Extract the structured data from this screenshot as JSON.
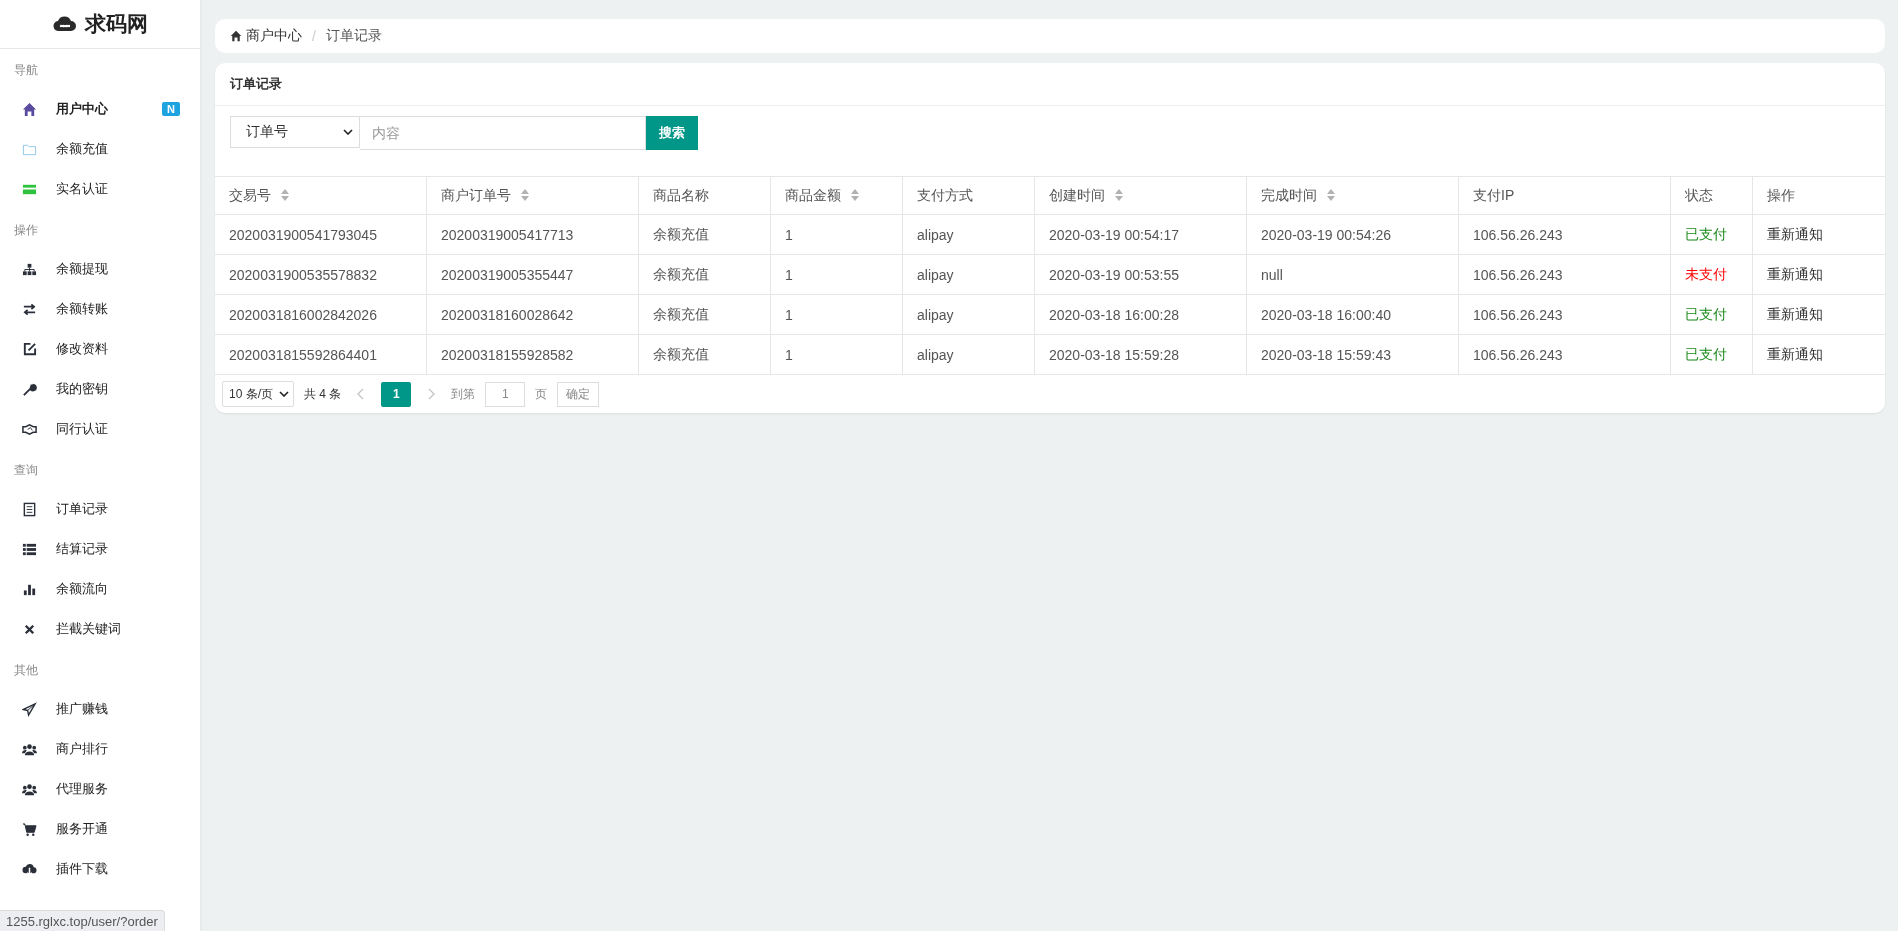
{
  "sidebar": {
    "logo": "求码网",
    "groups": [
      {
        "title": "导航",
        "items": [
          {
            "label": "用户中心",
            "selected": true,
            "badge": "N"
          },
          {
            "label": "余额充值",
            "selected": false
          },
          {
            "label": "实名认证",
            "selected": false
          }
        ]
      },
      {
        "title": "操作",
        "items": [
          {
            "label": "余额提现",
            "selected": false
          },
          {
            "label": "余额转账",
            "selected": false
          },
          {
            "label": "修改资料",
            "selected": false
          },
          {
            "label": "我的密钥",
            "selected": false
          },
          {
            "label": "同行认证",
            "selected": false
          }
        ]
      },
      {
        "title": "查询",
        "items": [
          {
            "label": "订单记录",
            "selected": false
          },
          {
            "label": "结算记录",
            "selected": false
          },
          {
            "label": "余额流向",
            "selected": false
          },
          {
            "label": "拦截关键词",
            "selected": false
          }
        ]
      },
      {
        "title": "其他",
        "items": [
          {
            "label": "推广赚钱",
            "selected": false
          },
          {
            "label": "商户排行",
            "selected": false
          },
          {
            "label": "代理服务",
            "selected": false
          },
          {
            "label": "服务开通",
            "selected": false
          },
          {
            "label": "插件下载",
            "selected": false
          }
        ]
      }
    ]
  },
  "breadcrumb": [
    "商户中心",
    "订单记录"
  ],
  "breadcrumb_separator": "/",
  "card": {
    "title": "订单记录",
    "search": {
      "field": "订单号",
      "placeholder": "内容",
      "button": "搜索"
    },
    "table": {
      "columns": [
        {
          "label": "交易号",
          "sortable": true
        },
        {
          "label": "商户订单号",
          "sortable": true
        },
        {
          "label": "商品名称",
          "sortable": false
        },
        {
          "label": "商品金额",
          "sortable": true
        },
        {
          "label": "支付方式",
          "sortable": false
        },
        {
          "label": "创建时间",
          "sortable": true
        },
        {
          "label": "完成时间",
          "sortable": true
        },
        {
          "label": "支付IP",
          "sortable": false
        },
        {
          "label": "状态",
          "sortable": false
        },
        {
          "label": "操作",
          "sortable": false
        }
      ],
      "rows": [
        {
          "cells": [
            "2020031900541793045",
            "20200319005417713",
            "余额充值",
            "1",
            "alipay",
            "2020-03-19 00:54:17",
            "2020-03-19 00:54:26",
            "106.56.26.243"
          ],
          "status": "已支付",
          "paid": true,
          "action": "重新通知"
        },
        {
          "cells": [
            "2020031900535578832",
            "20200319005355447",
            "余额充值",
            "1",
            "alipay",
            "2020-03-19 00:53:55",
            "null",
            "106.56.26.243"
          ],
          "status": "未支付",
          "paid": false,
          "action": "重新通知"
        },
        {
          "cells": [
            "2020031816002842026",
            "20200318160028642",
            "余额充值",
            "1",
            "alipay",
            "2020-03-18 16:00:28",
            "2020-03-18 16:00:40",
            "106.56.26.243"
          ],
          "status": "已支付",
          "paid": true,
          "action": "重新通知"
        },
        {
          "cells": [
            "2020031815592864401",
            "20200318155928582",
            "余额充值",
            "1",
            "alipay",
            "2020-03-18 15:59:28",
            "2020-03-18 15:59:43",
            "106.56.26.243"
          ],
          "status": "已支付",
          "paid": true,
          "action": "重新通知"
        }
      ]
    },
    "pagination": {
      "page_size": "10 条/页",
      "total": "共 4 条",
      "pages": [
        {
          "label": "1",
          "selected": true
        }
      ],
      "goto_label": "到第",
      "goto_value": "1",
      "page_unit": "页",
      "confirm": "确定"
    }
  },
  "status_bar": "1255.rglxc.top/user/?order"
}
